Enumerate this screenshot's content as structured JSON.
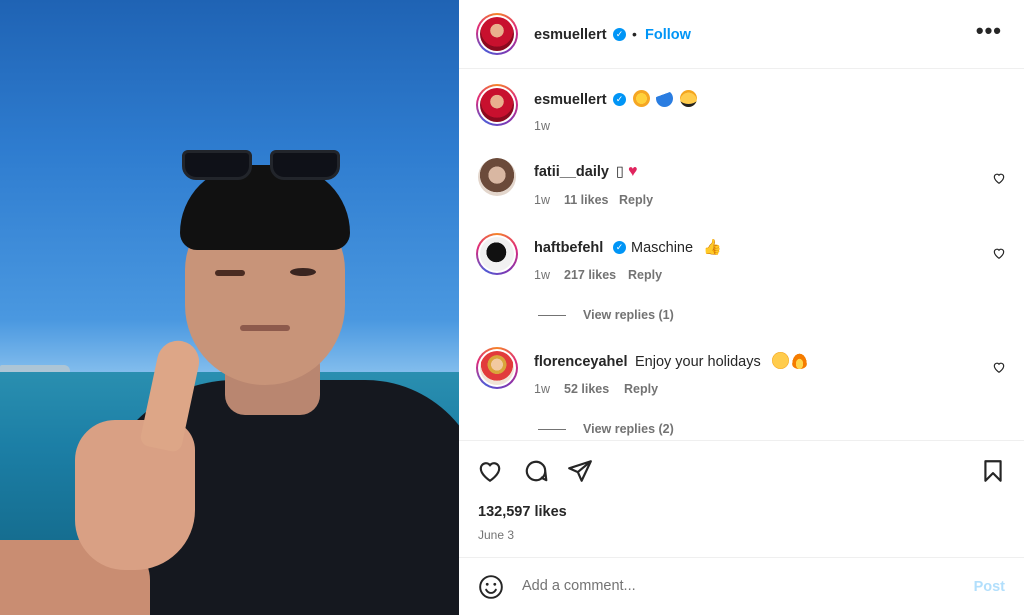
{
  "post": {
    "username": "esmuellert",
    "follow_label": "Follow",
    "dot": "•",
    "more_label": "•••"
  },
  "caption": {
    "username": "esmuellert",
    "emojis": [
      "sun-emoji",
      "wave-emoji",
      "sunglasses-emoji"
    ],
    "time": "1w"
  },
  "comments": [
    {
      "username": "fatii__daily",
      "text": "▯",
      "emojis": [
        "red-heart-emoji"
      ],
      "verified": false,
      "time": "1w",
      "likes": "11 likes",
      "reply": "Reply",
      "view_replies": ""
    },
    {
      "username": "haftbefehl",
      "text": "Maschine",
      "emojis": [
        "thumbs-up-emoji"
      ],
      "verified": true,
      "time": "1w",
      "likes": "217 likes",
      "reply": "Reply",
      "view_replies": "View replies (1)"
    },
    {
      "username": "florenceyahel",
      "text": "Enjoy your holidays",
      "emojis": [
        "heart-eyes-emoji",
        "fire-emoji"
      ],
      "verified": false,
      "time": "1w",
      "likes": "52 likes",
      "reply": "Reply",
      "view_replies": "View replies (2)"
    }
  ],
  "stats": {
    "likes": "132,597 likes",
    "date": "June 3"
  },
  "comment_box": {
    "placeholder": "Add a comment...",
    "post_label": "Post"
  },
  "colors": {
    "link": "#0095f6",
    "post_disabled": "#b2dffc",
    "muted": "#737373",
    "text": "#262626"
  }
}
